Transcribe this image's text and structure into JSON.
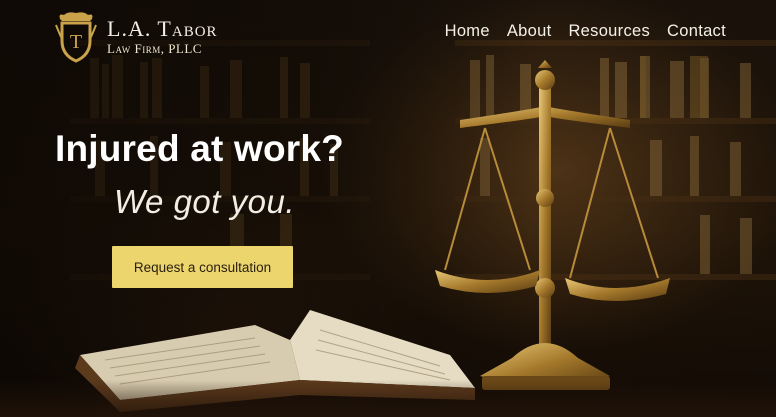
{
  "brand": {
    "name": "L.A. Tabor",
    "subtitle": "Law Firm, PLLC",
    "logo_icon": "shield-crest-icon",
    "logo_letter": "T",
    "accent": "#c9a24a"
  },
  "nav": {
    "items": [
      {
        "label": "Home"
      },
      {
        "label": "About"
      },
      {
        "label": "Resources"
      },
      {
        "label": "Contact"
      }
    ]
  },
  "hero": {
    "headline": "Injured at work?",
    "tagline": "We got you.",
    "cta_label": "Request a consultation",
    "cta_color": "#ecd56d",
    "background": "library-bookshelves-photo",
    "imagery": [
      "scales-of-justice-icon",
      "open-book-icon"
    ]
  }
}
